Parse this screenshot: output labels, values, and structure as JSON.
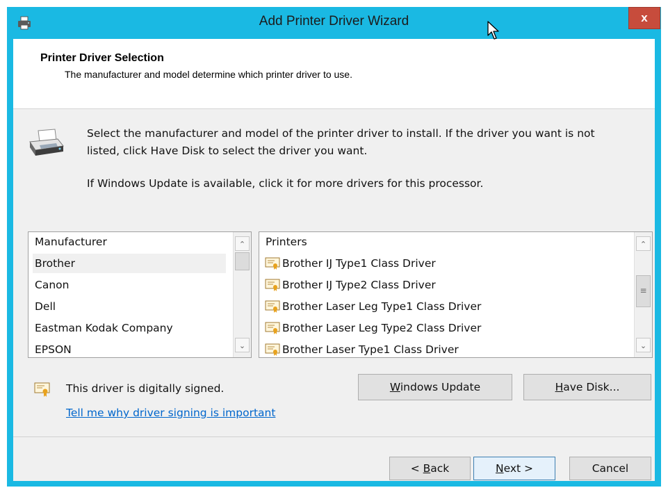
{
  "window": {
    "title": "Add Printer Driver Wizard",
    "close_label": "x"
  },
  "header": {
    "title": "Printer Driver Selection",
    "subtitle": "The manufacturer and model determine which printer driver to use."
  },
  "instructions": {
    "line1": "Select the manufacturer and model of the printer driver to install. If the driver you want is not",
    "line2": "listed, click Have Disk to select the driver you want.",
    "line3": "If Windows Update is available, click it for more drivers for this processor."
  },
  "manufacturer_list": {
    "header": "Manufacturer",
    "items": [
      "Brother",
      "Canon",
      "Dell",
      "Eastman Kodak Company",
      "EPSON"
    ],
    "selected": "Brother"
  },
  "printer_list": {
    "header": "Printers",
    "items": [
      "Brother IJ Type1 Class Driver",
      "Brother IJ Type2 Class Driver",
      "Brother Laser Leg Type1 Class Driver",
      "Brother Laser Leg Type2 Class Driver",
      "Brother Laser Type1 Class Driver"
    ]
  },
  "signing": {
    "status": "This driver is digitally signed.",
    "link": "Tell me why driver signing is important"
  },
  "buttons": {
    "windows_update": {
      "prefix": "",
      "accel": "W",
      "rest": "indows Update"
    },
    "have_disk": {
      "prefix": "",
      "accel": "H",
      "rest": "ave Disk..."
    },
    "back": {
      "prefix": "< ",
      "accel": "B",
      "rest": "ack"
    },
    "next": {
      "prefix": "",
      "accel": "N",
      "rest": "ext >"
    },
    "cancel": "Cancel"
  },
  "icons": {
    "app": "printer-icon",
    "wizard": "printer-icon",
    "signed": "certificate-icon",
    "cursor": "mouse-pointer-icon"
  },
  "colors": {
    "title_bar": "#1ab9e3",
    "close_button": "#c74c3c",
    "link": "#0066cc",
    "default_button_border": "#3c7fb1"
  }
}
